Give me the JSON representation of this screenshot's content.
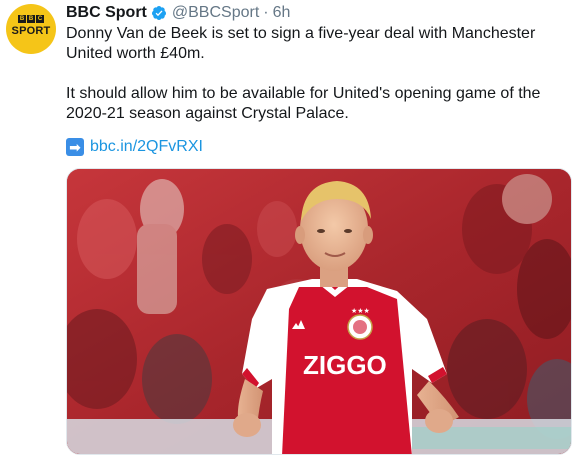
{
  "account": {
    "avatar_icon": "bbc-sport-logo",
    "avatar_letters": [
      "B",
      "B",
      "C"
    ],
    "avatar_word": "SPORT",
    "name": "BBC Sport",
    "verified_icon": "verified-badge-icon",
    "handle": "@BBCSport",
    "separator": "·",
    "time": "6h"
  },
  "tweet": {
    "paragraph1": "Donny Van de Beek is set to sign a five-year deal with Manchester United worth £40m.",
    "paragraph2": "It should allow him to be available for United's opening game of the 2020-21 season against Crystal Palace.",
    "link_icon": "right-arrow-emoji-icon",
    "link_arrow": "➡",
    "link_text": "bbc.in/2QFvRXI"
  },
  "media": {
    "image": "photo of footballer in red and white Ajax kit in a stadium",
    "shirt_sponsor": "ZIGGO"
  },
  "colors": {
    "avatar_bg": "#f5c518",
    "link": "#1b95e0",
    "verified": "#1da1f2",
    "meta_text": "#657786",
    "kit_red": "#d2122e"
  }
}
